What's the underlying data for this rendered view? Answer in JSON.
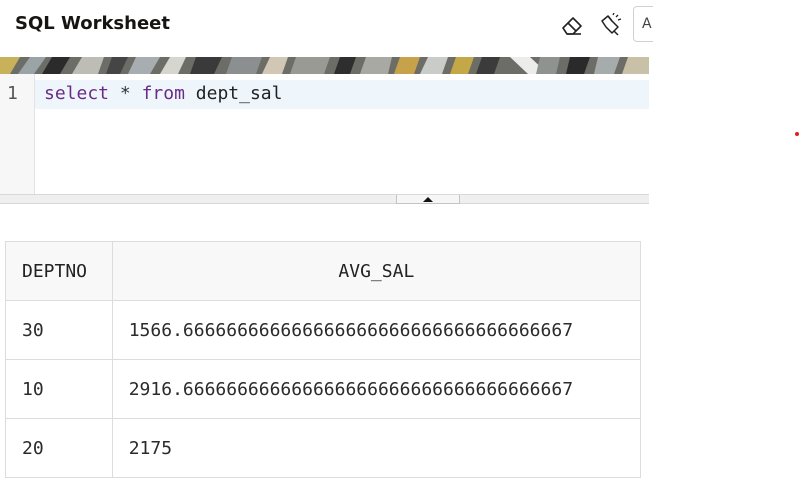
{
  "header": {
    "title": "SQL Worksheet",
    "extra_button_text": "A"
  },
  "editor": {
    "line_number": "1",
    "tokens": {
      "kw_select": "select",
      "op_star": "*",
      "kw_from": "from",
      "table": "dept_sal"
    }
  },
  "results": {
    "columns": [
      "DEPTNO",
      "AVG_SAL"
    ],
    "rows": [
      [
        "30",
        "1566.666666666666666666666666666666666667"
      ],
      [
        "10",
        "2916.666666666666666666666666666666666667"
      ],
      [
        "20",
        "2175"
      ]
    ]
  },
  "colors": {
    "keyword": "#6a2b86",
    "active_line": "#eef6fc",
    "indicator": "#e02020"
  },
  "icons": [
    "eraser-icon",
    "flashlight-icon",
    "collapse-arrow-icon"
  ]
}
